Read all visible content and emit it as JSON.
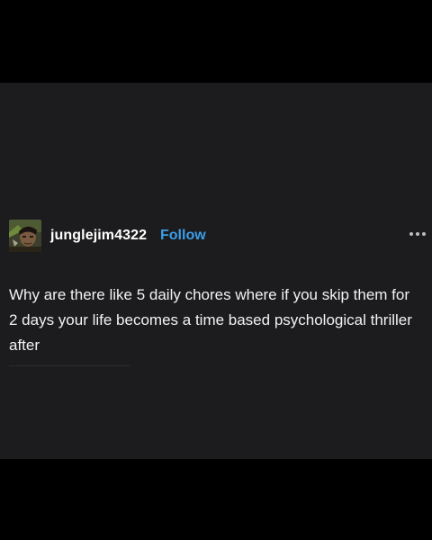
{
  "post": {
    "username": "junglejim4322",
    "follow_label": "Follow",
    "body_text": "Why are there like 5 daily chores where if you skip them for 2 days your life becomes a time based psychological thriller after"
  },
  "icons": {
    "avatar": "user-avatar-photo",
    "more": "more-options-icon"
  },
  "colors": {
    "background": "#000000",
    "panel": "#1c1c1e",
    "text": "#ffffff",
    "follow": "#3a9ee8"
  }
}
